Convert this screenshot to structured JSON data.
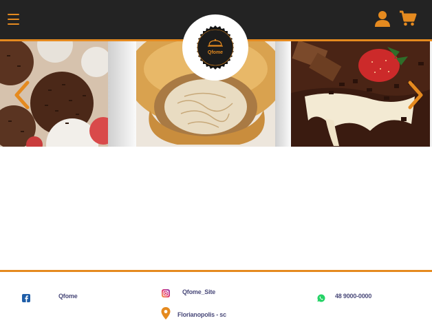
{
  "header": {
    "menu_icon": "hamburger-menu-icon",
    "user_icon": "user-icon",
    "cart_icon": "shopping-cart-icon",
    "accent_color": "#e58a1f",
    "background_color": "#232323"
  },
  "logo": {
    "text": "Qfome"
  },
  "carousel": {
    "slides": [
      {
        "subject": "brigadeiros-and-coconut-sweets"
      },
      {
        "subject": "chicken-pie"
      },
      {
        "subject": "chocolate-cake-with-strawberry"
      }
    ],
    "prev_icon": "chevron-left-icon",
    "next_icon": "chevron-right-icon"
  },
  "footer": {
    "facebook": {
      "icon": "facebook-icon",
      "label": "Qfome"
    },
    "instagram": {
      "icon": "instagram-icon",
      "label": "Qfome_Site"
    },
    "location": {
      "icon": "map-pin-icon",
      "label": "Florianopolis - sc"
    },
    "whatsapp": {
      "icon": "whatsapp-icon",
      "label": "48 9000-0000"
    }
  }
}
